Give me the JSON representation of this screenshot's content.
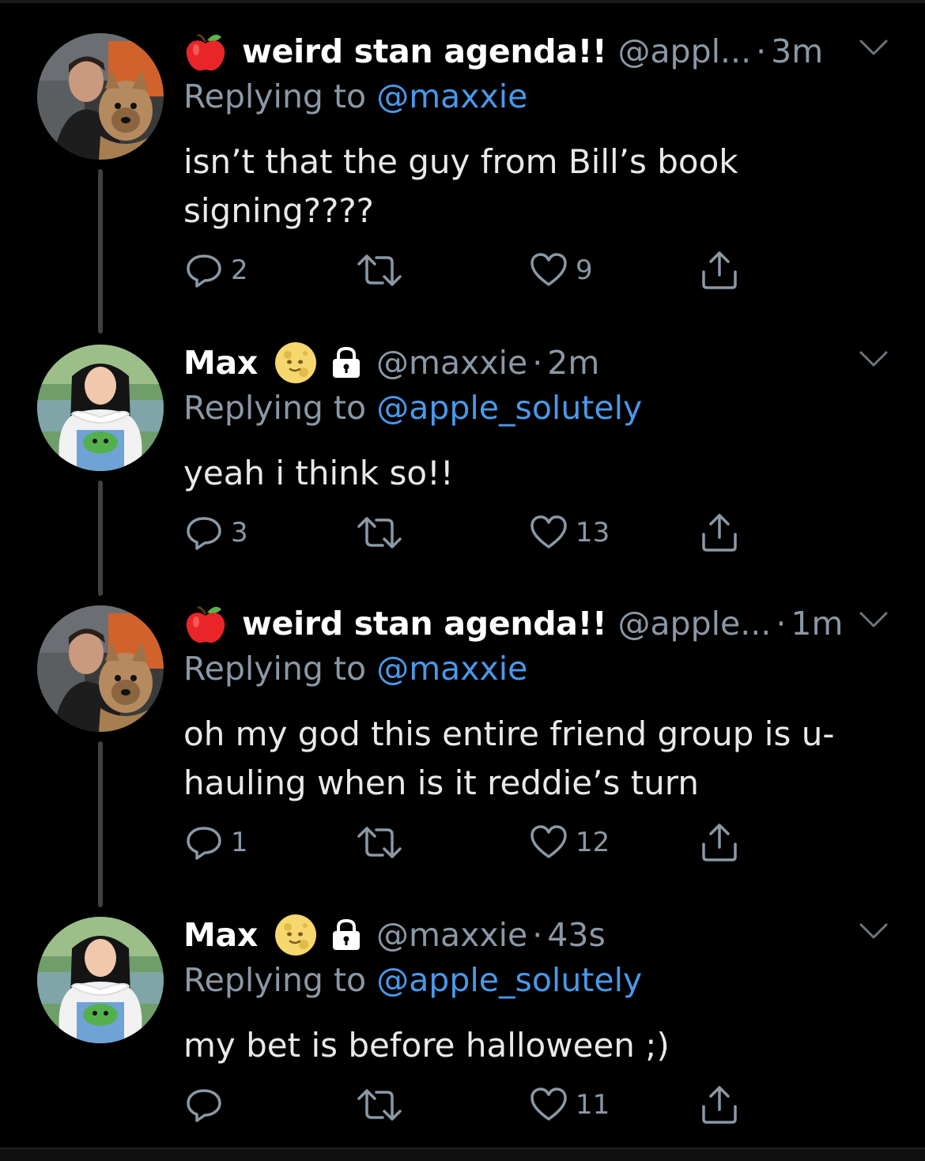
{
  "tweets": [
    {
      "display_name": "weird stan agenda!!",
      "name_emoji": "red-apple-icon",
      "handle": "@appl...",
      "time": "3m",
      "replying_prefix": "Replying to ",
      "replying_to": "@maxxie",
      "text": "isn’t that the guy from Bill’s book signing????",
      "replies": "2",
      "retweets": "",
      "likes": "9",
      "protected": false
    },
    {
      "display_name": "Max",
      "name_emoji": "moon-face-icon",
      "handle": "@maxxie",
      "time": "2m",
      "replying_prefix": "Replying to ",
      "replying_to": "@apple_solutely",
      "text": "yeah i think so!!",
      "replies": "3",
      "retweets": "",
      "likes": "13",
      "protected": true
    },
    {
      "display_name": "weird stan agenda!!",
      "name_emoji": "red-apple-icon",
      "handle": "@apple...",
      "time": "1m",
      "replying_prefix": "Replying to ",
      "replying_to": "@maxxie",
      "text": "oh my god this entire friend group is u-hauling when is it reddie’s turn",
      "replies": "1",
      "retweets": "",
      "likes": "12",
      "protected": false
    },
    {
      "display_name": "Max",
      "name_emoji": "moon-face-icon",
      "handle": "@maxxie",
      "time": "43s",
      "replying_prefix": "Replying to ",
      "replying_to": "@apple_solutely",
      "text": "my bet is before halloween ;)",
      "replies": "",
      "retweets": "",
      "likes": "11",
      "protected": true
    }
  ],
  "separator": "·",
  "colors": {
    "background": "#000000",
    "secondary_text": "#8b98a5",
    "mention": "#4a99e9",
    "thread_line": "#3d4144"
  }
}
